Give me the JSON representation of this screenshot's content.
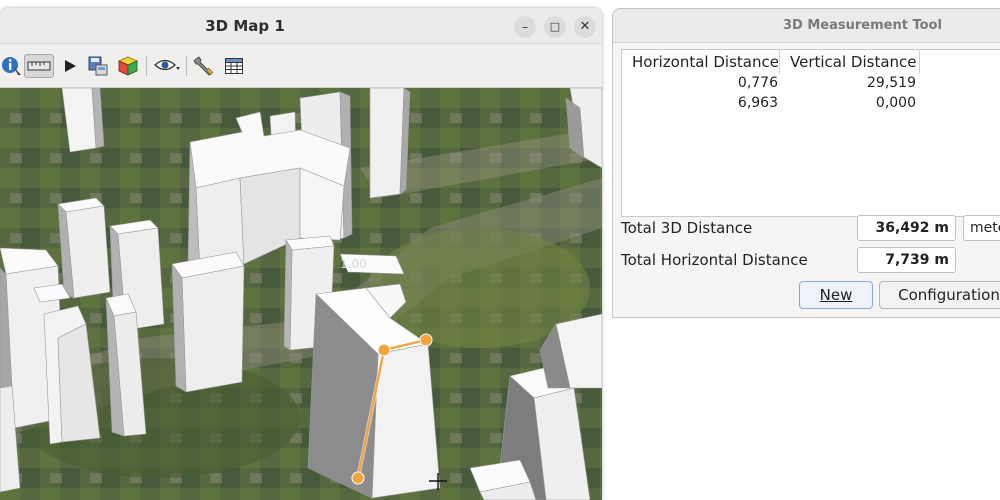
{
  "map_window": {
    "title": "3D Map 1",
    "controls": {
      "minimize": "–",
      "maximize": "□",
      "close": "✕"
    },
    "toolbar_icons": [
      "identify-icon",
      "measure-ruler-icon",
      "play-icon",
      "save-scene-icon",
      "cube-layers-icon",
      "eye-visibility-icon",
      "wrench-icon",
      "table-icon"
    ],
    "scale_label": "1.00"
  },
  "measure_window": {
    "title": "3D Measurement Tool",
    "table": {
      "columns": [
        "Horizontal Distance",
        "Vertical Distance"
      ],
      "rows": [
        {
          "horizontal": "0,776",
          "vertical": "29,519"
        },
        {
          "horizontal": "6,963",
          "vertical": "0,000"
        }
      ]
    },
    "total_3d_label": "Total 3D Distance",
    "total_3d_value": "36,492 m",
    "unit": "mete",
    "total_horizontal_label": "Total Horizontal Distance",
    "total_horizontal_value": "7,739 m",
    "new_button": "New",
    "configuration_button": "Configuration"
  }
}
